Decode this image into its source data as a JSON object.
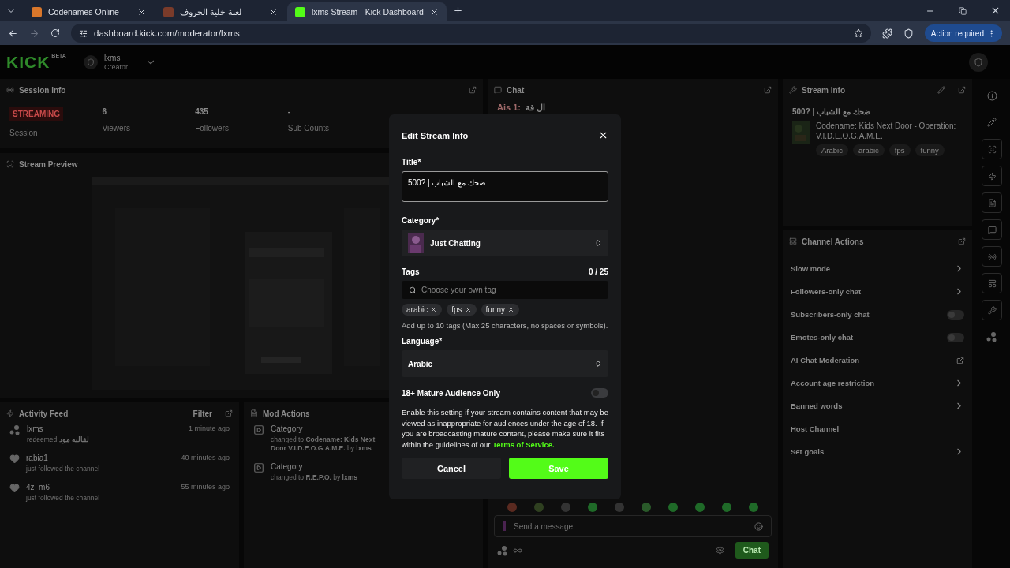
{
  "browser": {
    "tabs": [
      {
        "label": "Codenames Online",
        "selected": false
      },
      {
        "label": "لعبة خلية الحروف",
        "selected": false
      },
      {
        "label": "lxms Stream - Kick Dashboard",
        "selected": true
      }
    ],
    "url": "dashboard.kick.com/moderator/lxms",
    "action": "Action required"
  },
  "header": {
    "logo": "KICK",
    "logo_badge": "BETA",
    "channel": "lxms",
    "role": "Creator"
  },
  "session_info": {
    "title": "Session Info",
    "stats": [
      {
        "kind": "badge",
        "value": "STREAMING",
        "label": "Session"
      },
      {
        "kind": "stat",
        "value": "6",
        "label": "Viewers"
      },
      {
        "kind": "stat",
        "value": "435",
        "label": "Followers"
      },
      {
        "kind": "stat",
        "value": "-",
        "label": "Sub Counts"
      }
    ]
  },
  "stream_preview": {
    "title": "Stream Preview"
  },
  "activity_feed": {
    "title": "Activity Feed",
    "filter": "Filter",
    "items": [
      {
        "kind": "redeem",
        "user": "lxms",
        "action": "redeemed **لقالبه مود**",
        "time": "1 minute ago"
      },
      {
        "kind": "follow",
        "user": "rabia1",
        "action": "just followed the channel",
        "time": "40 minutes ago"
      },
      {
        "kind": "follow",
        "user": "4z_m6",
        "action": "just followed the channel",
        "time": "55 minutes ago"
      }
    ]
  },
  "mod_actions": {
    "title": "Mod Actions",
    "items": [
      {
        "title": "Category",
        "text": "changed to **Codename: Kids Next Door** **V.I.D.E.O.G.A.M.E.** by **lxms**"
      },
      {
        "title": "Category",
        "text": "changed to **R.E.P.O.** by **lxms**"
      }
    ]
  },
  "chat": {
    "title": "Chat",
    "messages": [
      {
        "user": "Ais 1:",
        "text": "ال قة"
      }
    ],
    "placeholder": "Send a message",
    "send": "Chat"
  },
  "stream_info": {
    "title": "Stream info",
    "stream_title": "500? | ضحك مع الشباب",
    "category": "Codename: Kids Next Door - Operation: V.I.D.E.O.G.A.M.E.",
    "tags": [
      "Arabic",
      "arabic",
      "fps",
      "funny"
    ]
  },
  "channel_actions": {
    "title": "Channel Actions",
    "items": [
      {
        "kind": "chevron",
        "label": "Slow mode"
      },
      {
        "kind": "chevron",
        "label": "Followers-only chat"
      },
      {
        "kind": "toggle",
        "label": "Subscribers-only chat",
        "on": false
      },
      {
        "kind": "toggle",
        "label": "Emotes-only chat",
        "on": false
      },
      {
        "kind": "external",
        "label": "AI Chat Moderation"
      },
      {
        "kind": "chevron",
        "label": "Account age restriction"
      },
      {
        "kind": "chevron",
        "label": "Banned words"
      },
      {
        "kind": "plain",
        "label": "Host Channel"
      },
      {
        "kind": "chevron",
        "label": "Set goals"
      }
    ]
  },
  "dialog": {
    "title": "Edit Stream Info",
    "title_label": "Title*",
    "title_value": "500? | ضحك مع الشباب",
    "category_label": "Category*",
    "category_value": "Just Chatting",
    "tags_label": "Tags",
    "tags_count": "0 / 25",
    "tags_placeholder": "Choose your own tag",
    "tags": [
      "arabic",
      "fps",
      "funny"
    ],
    "tags_hint": "Add up to 10 tags (Max 25 characters, no spaces or symbols).",
    "language_label": "Language*",
    "language_value": "Arabic",
    "mature": {
      "label": "18+ Mature Audience Only",
      "on": false
    },
    "mature_text": "Enable this setting if your stream contains content that may be viewed as inappropriate for audiences under the age of 18. If you are broadcasting mature content, please make sure it fits within the guidelines of our",
    "mature_link": "Terms of Service.",
    "cancel": "Cancel",
    "save": "Save"
  }
}
